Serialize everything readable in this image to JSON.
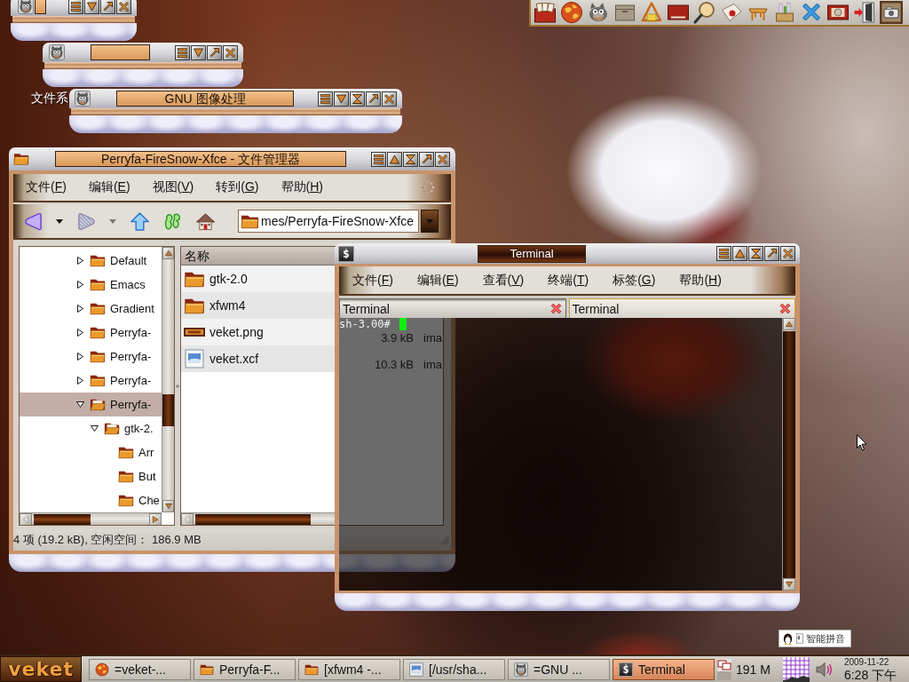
{
  "desktop_icons": [
    {
      "label": "文件系"
    }
  ],
  "shaded_windows": [
    {
      "active": false,
      "shaded": true,
      "buttons": [
        {
          "kind": "menu"
        },
        {
          "kind": "shade"
        },
        {
          "kind": "maximize"
        },
        {
          "kind": "close"
        }
      ]
    },
    {
      "active": false,
      "shaded": true,
      "buttons": [
        {
          "kind": "menu"
        },
        {
          "kind": "shade"
        },
        {
          "kind": "maximize"
        },
        {
          "kind": "close"
        }
      ]
    },
    {
      "title": "GNU 图像处理",
      "active": false,
      "shaded": true,
      "buttons": [
        {
          "kind": "menu"
        },
        {
          "kind": "shade"
        },
        {
          "kind": "hide"
        },
        {
          "kind": "maximize"
        },
        {
          "kind": "close"
        }
      ]
    }
  ],
  "file_manager": {
    "title": "Perryfa-FireSnow-Xfce - 文件管理器",
    "active": false,
    "shaded": false,
    "buttons": [
      {
        "kind": "menu"
      },
      {
        "kind": "shade"
      },
      {
        "kind": "hide"
      },
      {
        "kind": "maximize"
      },
      {
        "kind": "close"
      }
    ],
    "menu": [
      {
        "label": "文件(F)"
      },
      {
        "label": "编辑(E)"
      },
      {
        "label": "视图(V)"
      },
      {
        "label": "转到(G)"
      },
      {
        "label": "帮助(H)"
      }
    ],
    "toolbar": [
      {
        "kind": "back",
        "disabled": false
      },
      {
        "kind": "history",
        "disabled": false
      },
      {
        "kind": "forward",
        "disabled": true
      },
      {
        "kind": "history",
        "disabled": true
      },
      {
        "kind": "up",
        "disabled": false
      },
      {
        "kind": "footprints",
        "disabled": false
      },
      {
        "kind": "home",
        "disabled": false
      }
    ],
    "location": {
      "value": "mes/Perryfa-FireSnow-Xfce"
    },
    "tree": [
      {
        "label": "Default",
        "expanded": false,
        "selected": false
      },
      {
        "label": "Emacs",
        "expanded": false,
        "selected": false
      },
      {
        "label": "Gradient",
        "expanded": false,
        "selected": false
      },
      {
        "label": "Perryfa-",
        "expanded": false,
        "selected": false
      },
      {
        "label": "Perryfa-",
        "expanded": false,
        "selected": false
      },
      {
        "label": "Perryfa-",
        "expanded": false,
        "selected": false
      },
      {
        "label": "Perryfa-",
        "expanded": true,
        "selected": true,
        "children": [
          {
            "label": "gtk-2.",
            "expanded": true,
            "selected": false,
            "children": [
              {
                "label": "Arr",
                "selected": false
              },
              {
                "label": "But",
                "selected": false
              },
              {
                "label": "Che",
                "selected": false
              }
            ]
          }
        ]
      }
    ],
    "list": {
      "columns": [
        "名称"
      ],
      "rows": [
        {
          "name": "gtk-2.0",
          "kind": "folder"
        },
        {
          "name": "xfwm4",
          "kind": "folder"
        },
        {
          "name": "veket.png",
          "kind": "png",
          "size": "3.9 kB",
          "type": "ima"
        },
        {
          "name": "veket.xcf",
          "kind": "xcf",
          "size": "10.3 kB",
          "type": "ima"
        }
      ]
    },
    "status": "4 项 (19.2 kB), 空闲空间： 186.9 MB"
  },
  "terminal": {
    "title": "Terminal",
    "icon_glyph": "$",
    "active": true,
    "shaded": false,
    "buttons": [
      {
        "kind": "menu"
      },
      {
        "kind": "shade"
      },
      {
        "kind": "hide"
      },
      {
        "kind": "maximize"
      },
      {
        "kind": "close"
      }
    ],
    "menu": [
      {
        "label": "文件(F)"
      },
      {
        "label": "编辑(E)"
      },
      {
        "label": "查看(V)"
      },
      {
        "label": "终端(T)"
      },
      {
        "label": "标签(G)"
      },
      {
        "label": "帮助(H)"
      }
    ],
    "tabs": [
      {
        "label": "Terminal",
        "selected": false
      },
      {
        "label": "Terminal",
        "selected": true
      }
    ],
    "prompt": "sh-3.00#"
  },
  "taskbar": {
    "start_label": "veket",
    "tasks": [
      {
        "label": "=veket-...",
        "kind": "browser",
        "selected": false
      },
      {
        "label": "Perryfa-F...",
        "kind": "folder",
        "selected": false
      },
      {
        "label": "[xfwm4 -...",
        "kind": "folder",
        "selected": false
      },
      {
        "label": "[/usr/sha...",
        "kind": "image",
        "selected": false
      },
      {
        "label": "=GNU ...",
        "kind": "mascot",
        "selected": false
      },
      {
        "label": "Terminal",
        "kind": "terminal",
        "icon_glyph": "$",
        "selected": true
      }
    ],
    "memory": "191 M",
    "date": "2009-11-22",
    "time": "6:28 下午"
  },
  "input_method": {
    "label": "智能拼音"
  }
}
